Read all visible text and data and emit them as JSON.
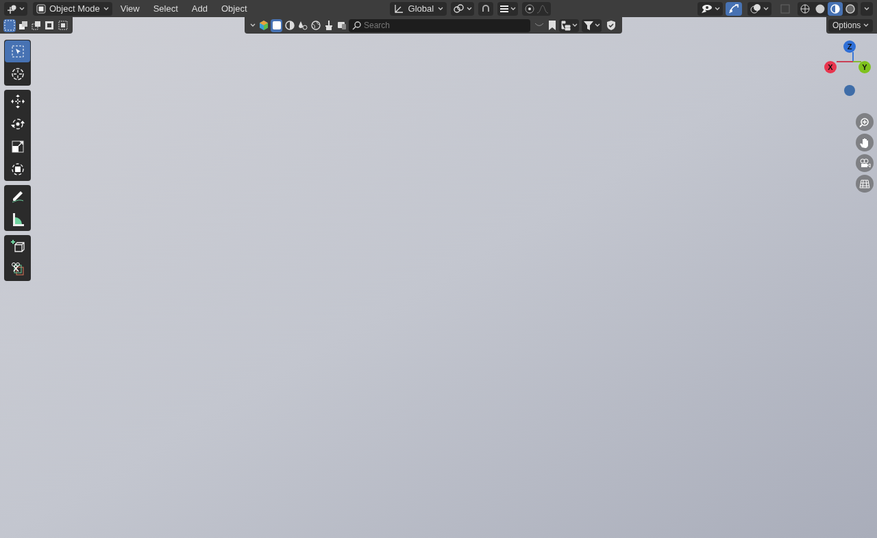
{
  "header": {
    "mode": "Object Mode",
    "menus": [
      "View",
      "Select",
      "Add",
      "Object"
    ],
    "orientation": "Global",
    "toggles": [
      {
        "on": false
      },
      {
        "on": false
      },
      {
        "on": false
      },
      {
        "on": false
      }
    ],
    "shading": [
      {
        "selected": false
      },
      {
        "selected": false
      },
      {
        "selected": true
      },
      {
        "selected": false
      }
    ]
  },
  "tool_header": {
    "select_modes": [
      {
        "selected": true
      },
      {
        "selected": false
      },
      {
        "selected": false
      },
      {
        "selected": false
      },
      {
        "selected": false
      }
    ],
    "filters": [
      {
        "selected": false
      },
      {
        "selected": true
      },
      {
        "selected": false
      },
      {
        "selected": false
      },
      {
        "selected": false
      },
      {
        "selected": false
      },
      {
        "selected": false
      }
    ],
    "search": {
      "placeholder": "Search"
    },
    "options": "Options"
  },
  "toolbar": {
    "groups": [
      {
        "tools": [
          {
            "selected": true
          },
          {
            "selected": false
          }
        ]
      },
      {
        "tools": [
          {
            "selected": false
          },
          {
            "selected": false
          },
          {
            "selected": false
          },
          {
            "selected": false
          }
        ]
      },
      {
        "tools": [
          {
            "selected": false
          },
          {
            "selected": false
          }
        ]
      },
      {
        "tools": [
          {
            "selected": false
          },
          {
            "selected": false
          }
        ]
      }
    ]
  },
  "gizmo": {
    "axes": [
      {
        "label": "Z",
        "color": "#2f6fd6"
      },
      {
        "label": "X",
        "color": "#e8364f"
      },
      {
        "label": "Y",
        "color": "#7fc21d"
      }
    ]
  }
}
